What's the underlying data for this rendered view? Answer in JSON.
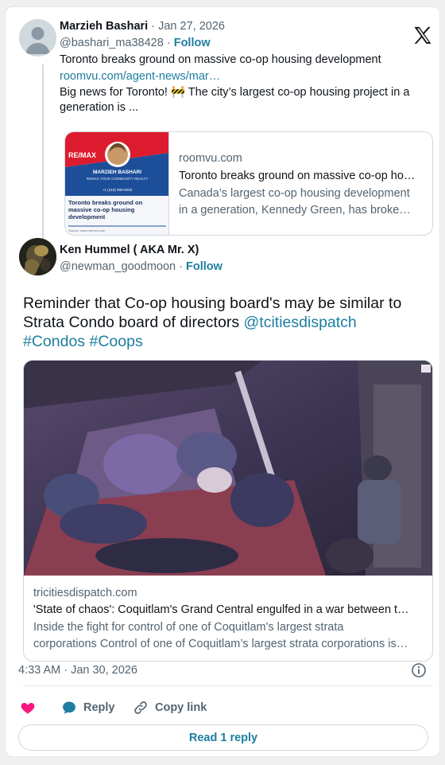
{
  "quoted_tweet": {
    "author_name": "Marzieh Bashari",
    "date": "· Jan 27, 2026",
    "handle": "@bashari_ma38428",
    "separator": "·",
    "follow": "Follow",
    "title_line": "Toronto breaks ground on massive co-op housing development",
    "url": "roomvu.com/agent-news/mar…",
    "body_line1": "Big news for Toronto! 🚧 The city’s largest co-op housing project in a",
    "body_line2": "generation is ...",
    "card": {
      "domain": "roomvu.com",
      "title": "Toronto breaks ground on massive co-op ho…",
      "desc_line1": "Canada’s largest co-op housing development",
      "desc_line2": "in a generation, Kennedy Green, has broke…",
      "thumb": {
        "brand": "RE/MAX",
        "agent": "MARZIEH BASHARI",
        "tagline": "REMAX YOUR COMMUNITY REALTY",
        "phone": "+1 (416) 389-9233",
        "headline": "Toronto breaks ground on massive co-op housing development",
        "source": "Source: www.roomvu.com"
      }
    }
  },
  "main_tweet": {
    "author_name": "Ken Hummel ( AKA Mr. X)",
    "handle": "@newman_goodmoon",
    "separator": "·",
    "follow": "Follow",
    "text_line1": "Reminder that Co-op housing board's may be similar to",
    "text_line2_plain": "Strata Condo board of directors ",
    "mention": "@tcitiesdispatch",
    "hashtag1": "#Condos",
    "hashtag2": "#Coops",
    "link_card": {
      "domain": "tricitiesdispatch.com",
      "title": "'State of chaos': Coquitlam's Grand Central engulfed in a war between t…",
      "desc_line1": "Inside the fight for control of one of Coquitlam's largest strata",
      "desc_line2": "corporations Control of one of Coquitlam’s largest strata corporations is…"
    },
    "timestamp": "4:33 AM · Jan 30, 2026",
    "actions": {
      "reply": "Reply",
      "copy_link": "Copy link"
    },
    "read_replies": "Read 1 reply"
  },
  "colors": {
    "accent": "#1d7ea0",
    "muted": "#536471",
    "heart": "#f91880",
    "remax_red": "#dc1c2e",
    "remax_blue": "#1d4e9a"
  },
  "icons": [
    "x-logo-icon",
    "info-icon",
    "heart-icon",
    "reply-bubble-icon",
    "link-icon"
  ]
}
